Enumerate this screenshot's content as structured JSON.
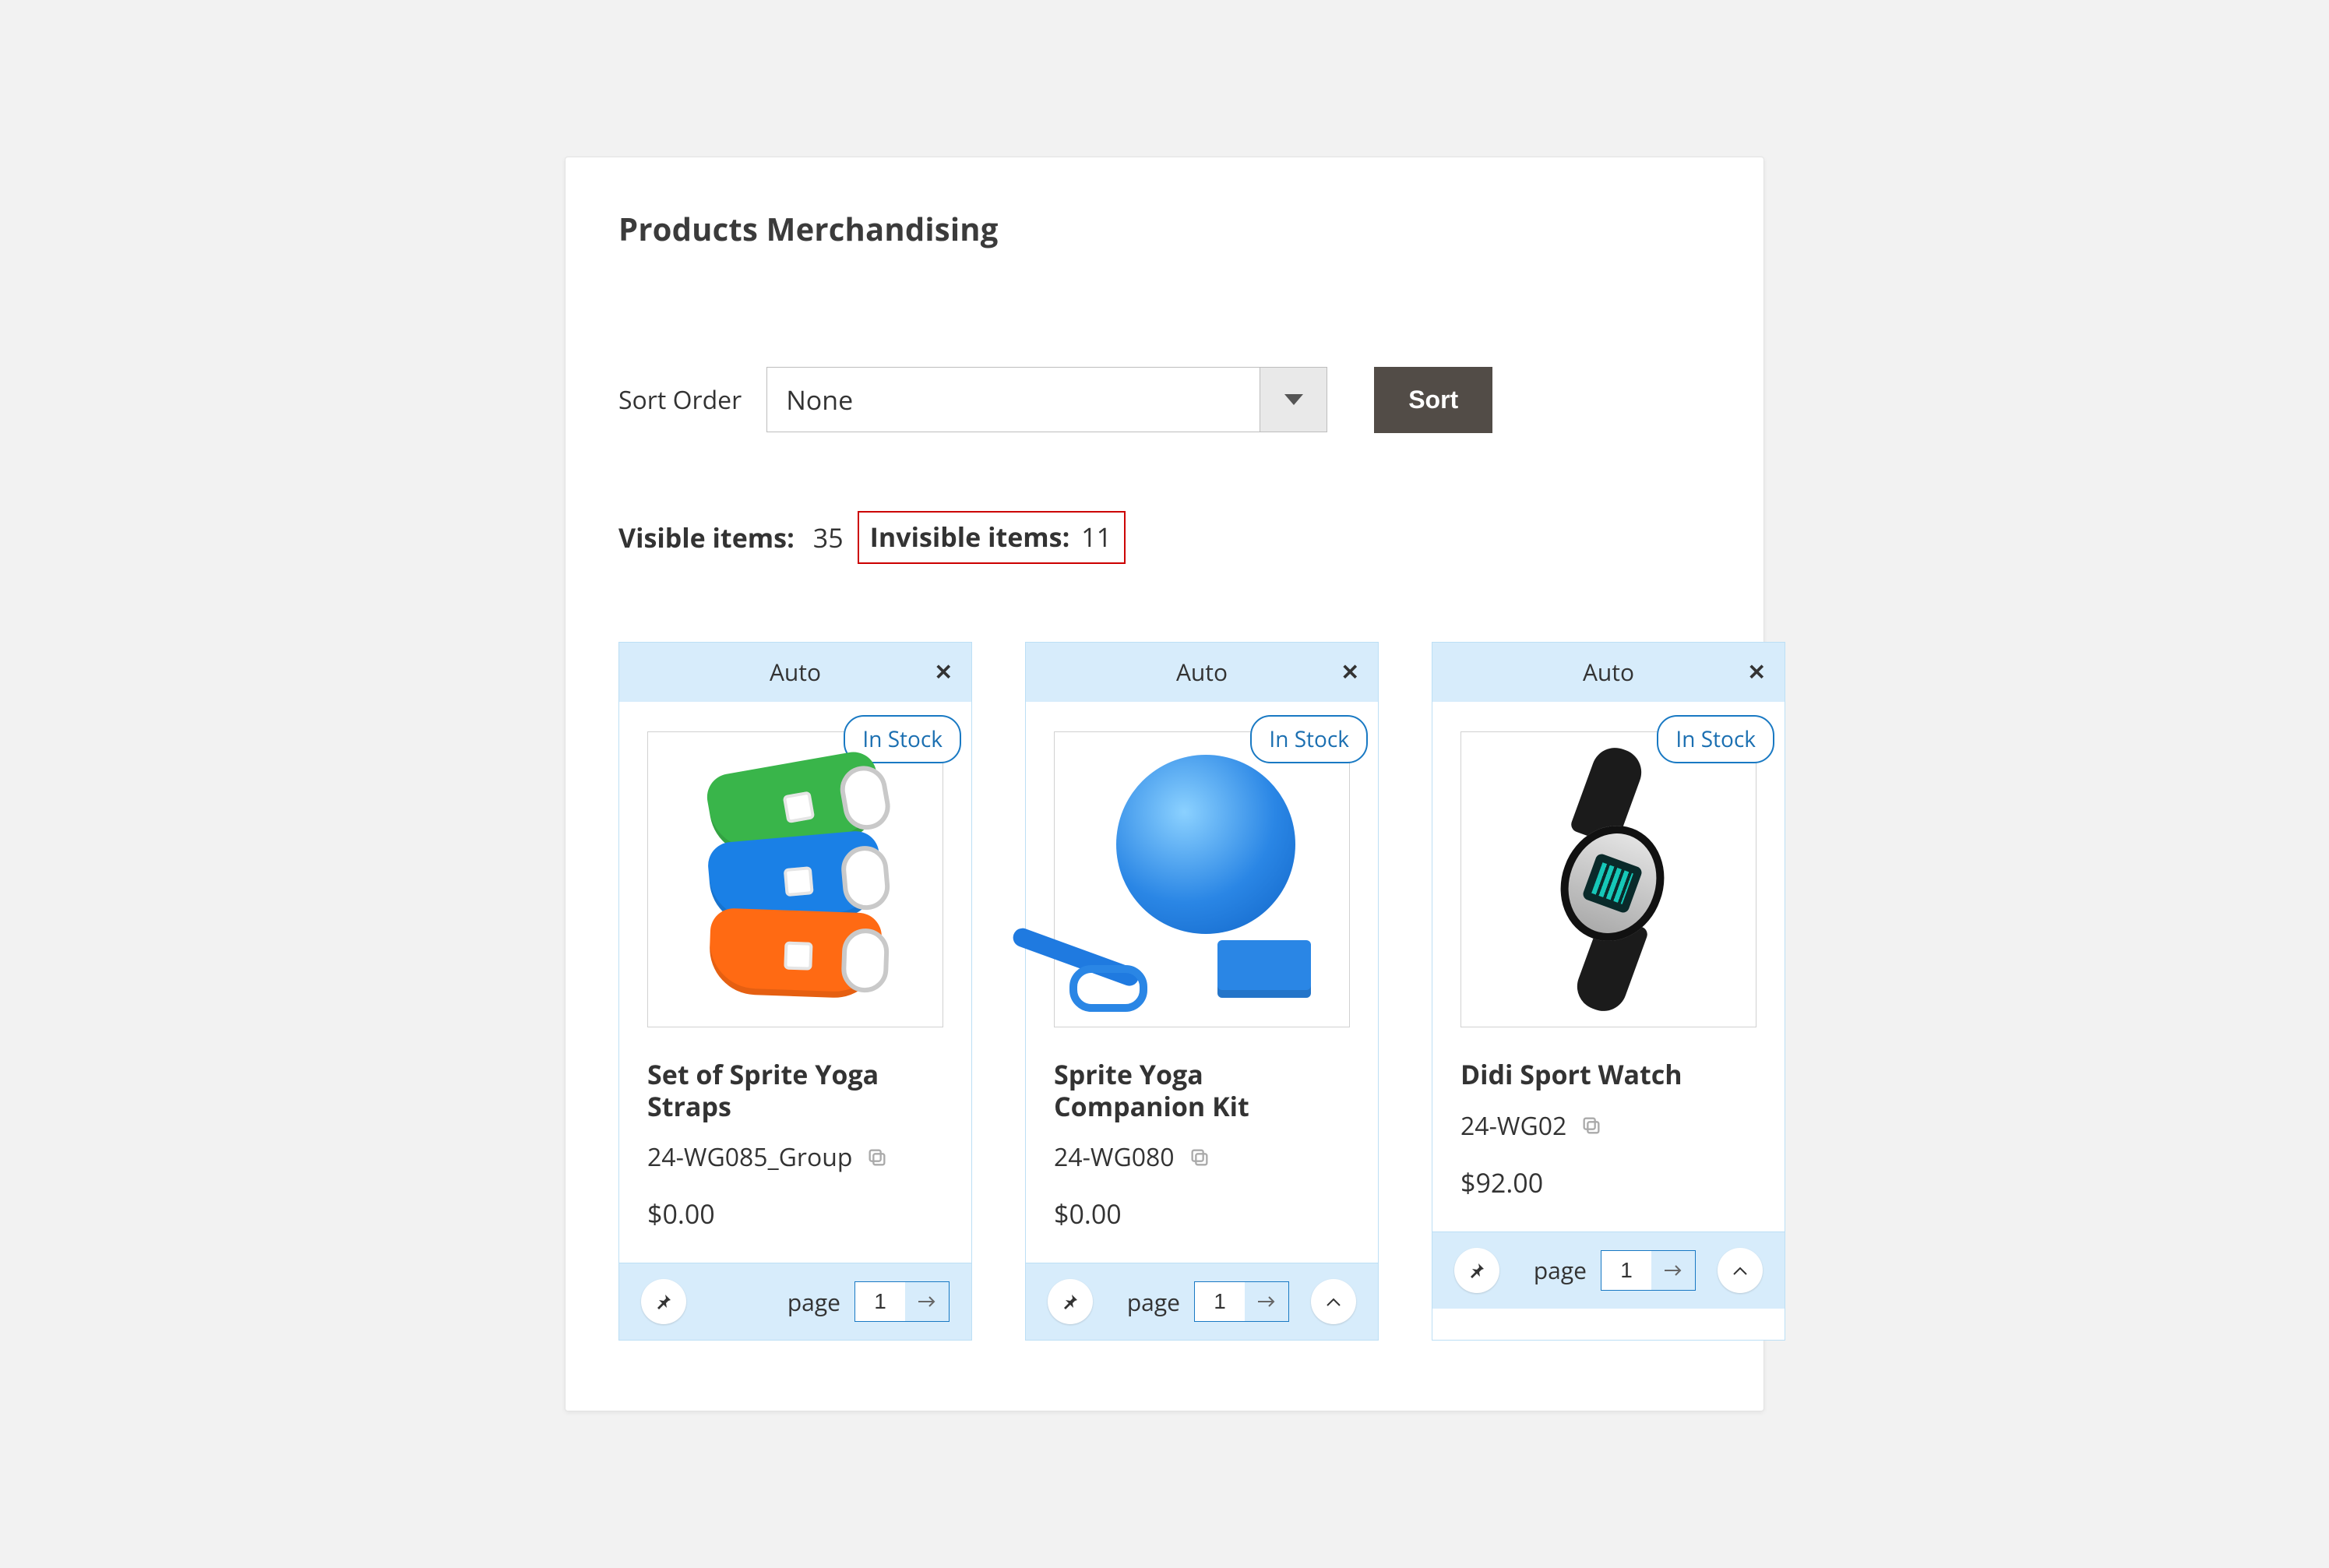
{
  "section_title": "Products Merchandising",
  "sort": {
    "label": "Sort Order",
    "selected": "None",
    "button": "Sort"
  },
  "counts": {
    "visible_label": "Visible items:",
    "visible_value": "35",
    "invisible_label": "Invisible items:",
    "invisible_value": "11"
  },
  "card_labels": {
    "auto": "Auto",
    "in_stock": "In Stock",
    "page": "page"
  },
  "products": [
    {
      "name": "Set of Sprite Yoga Straps",
      "sku": "24-WG085_Group",
      "price": "$0.00",
      "page_value": "1",
      "show_caret": false
    },
    {
      "name": "Sprite Yoga Companion Kit",
      "sku": "24-WG080",
      "price": "$0.00",
      "page_value": "1",
      "show_caret": true
    },
    {
      "name": "Didi Sport Watch",
      "sku": "24-WG02",
      "price": "$92.00",
      "page_value": "1",
      "show_caret": true
    }
  ]
}
